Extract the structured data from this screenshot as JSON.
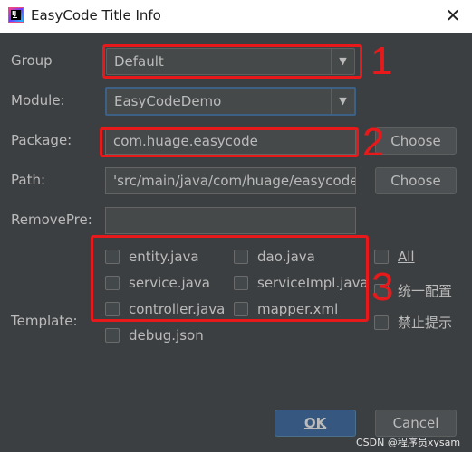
{
  "window": {
    "title": "EasyCode Title Info",
    "app_icon_text": "IJ"
  },
  "form": {
    "group_label": "Group",
    "group_value": "Default",
    "module_label": "Module:",
    "module_value": "EasyCodeDemo",
    "package_label": "Package:",
    "package_value": "com.huage.easycode",
    "path_label": "Path:",
    "path_value": "'src/main/java/com/huage/easycode",
    "removepre_label": "RemovePre:",
    "removepre_value": "",
    "template_label": "Template:",
    "choose_label": "Choose"
  },
  "templates": [
    {
      "label": "entity.java",
      "checked": false
    },
    {
      "label": "dao.java",
      "checked": false
    },
    {
      "label": "service.java",
      "checked": false
    },
    {
      "label": "serviceImpl.java",
      "checked": false
    },
    {
      "label": "controller.java",
      "checked": false
    },
    {
      "label": "mapper.xml",
      "checked": false
    },
    {
      "label": "debug.json",
      "checked": false
    }
  ],
  "options": {
    "all_label": "All",
    "unified_config_label": "统一配置",
    "disable_hint_label": "禁止提示"
  },
  "footer": {
    "ok_label": "OK",
    "cancel_label": "Cancel"
  },
  "annotations": {
    "n1": "1",
    "n2": "2",
    "n3": "3"
  },
  "watermark": "CSDN @程序员xysam",
  "colors": {
    "annotation": "#e8191a",
    "background": "#3c3f41",
    "primary": "#365880"
  }
}
